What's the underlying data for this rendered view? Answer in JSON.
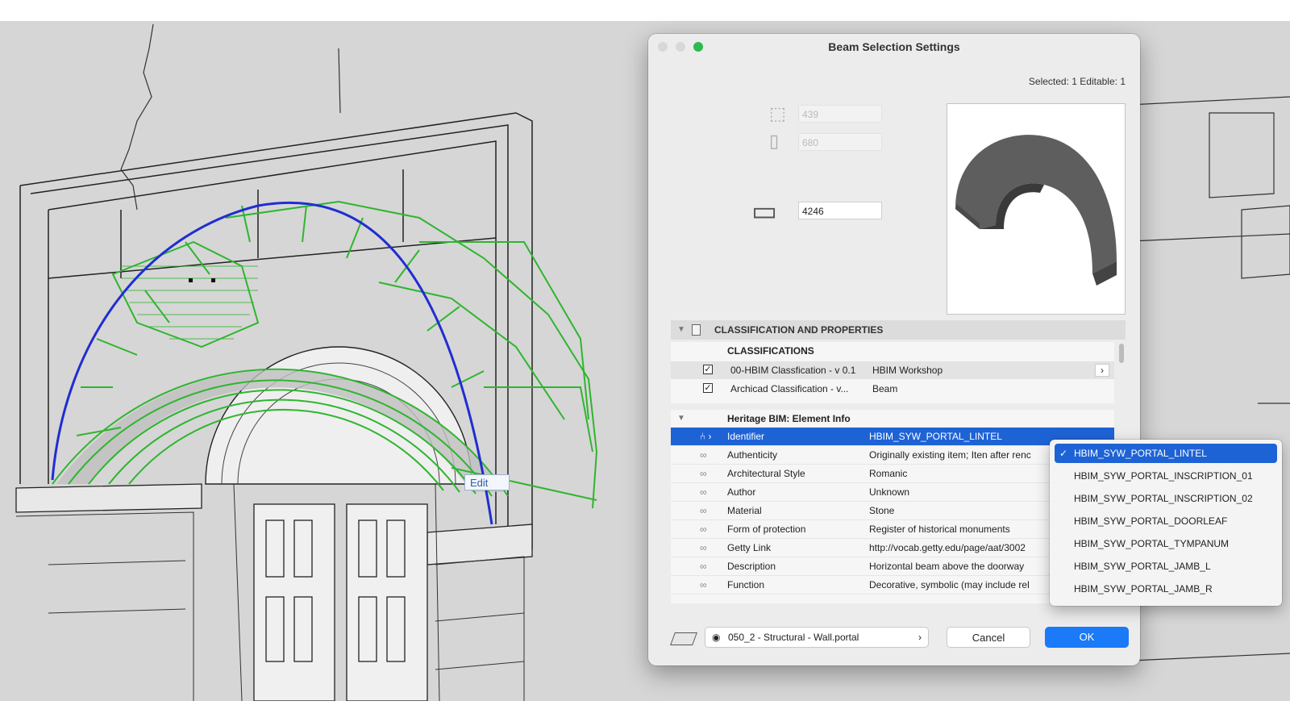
{
  "scene": {
    "edit_label": "Edit"
  },
  "dialog": {
    "title": "Beam Selection Settings",
    "selected_info": "Selected: 1 Editable: 1",
    "geometry": {
      "width_value": "439",
      "height_value": "680",
      "length_value": "4246"
    },
    "section_title": "CLASSIFICATION AND PROPERTIES",
    "classifications": {
      "header": "CLASSIFICATIONS",
      "rows": [
        {
          "name": "00-HBIM Classfication - v 0.1",
          "value": "HBIM Workshop",
          "checked": true
        },
        {
          "name": "Archicad Classification - v...",
          "value": "Beam",
          "checked": true
        }
      ]
    },
    "properties": {
      "group": "Heritage BIM: Element Info",
      "rows": [
        {
          "name": "Identifier",
          "value": "HBIM_SYW_PORTAL_LINTEL"
        },
        {
          "name": "Authenticity",
          "value": "Originally existing item; Iten after renc"
        },
        {
          "name": "Architectural Style",
          "value": "Romanic"
        },
        {
          "name": "Author",
          "value": "Unknown"
        },
        {
          "name": "Material",
          "value": "Stone"
        },
        {
          "name": "Form of protection",
          "value": "Register of historical monuments"
        },
        {
          "name": "Getty Link",
          "value": "http://vocab.getty.edu/page/aat/3002"
        },
        {
          "name": "Description",
          "value": "Horizontal beam above the doorway"
        },
        {
          "name": "Function",
          "value": "Decorative, symbolic (may include rel"
        }
      ]
    },
    "footer": {
      "layer_label": "050_2 - Structural - Wall.portal",
      "cancel": "Cancel",
      "ok": "OK"
    }
  },
  "dropdown": {
    "selected": "HBIM_SYW_PORTAL_LINTEL",
    "options": [
      "HBIM_SYW_PORTAL_LINTEL",
      "HBIM_SYW_PORTAL_INSCRIPTION_01",
      "HBIM_SYW_PORTAL_INSCRIPTION_02",
      "HBIM_SYW_PORTAL_DOORLEAF",
      "HBIM_SYW_PORTAL_TYMPANUM",
      "HBIM_SYW_PORTAL_JAMB_L",
      "HBIM_SYW_PORTAL_JAMB_R"
    ]
  },
  "colors": {
    "selection_green": "#2fb52f",
    "axis_blue": "#1f2ed1",
    "accent_blue": "#1a7af8",
    "row_selected": "#1e63d6"
  }
}
